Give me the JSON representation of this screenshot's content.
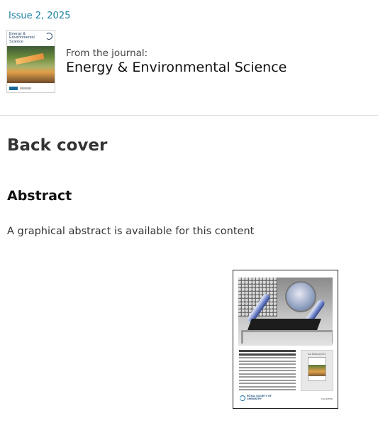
{
  "issue": {
    "label": "Issue 2, 2025"
  },
  "journal": {
    "from_label": "From the journal:",
    "name": "Energy & Environmental Science",
    "cover_title": "Energy & Environmental Science"
  },
  "article": {
    "type": "Back cover",
    "abstract_heading": "Abstract",
    "abstract_text": "A graphical abstract is available for this content"
  },
  "graphical_abstract": {
    "featured_label": "As featured in:",
    "publisher_logo_text": "ROYAL SOCIETY OF CHEMISTRY",
    "publisher_url": "rsc.li/ees"
  },
  "colors": {
    "link": "#1a7fa3",
    "heading": "#333333",
    "divider": "#dcdcdc"
  }
}
